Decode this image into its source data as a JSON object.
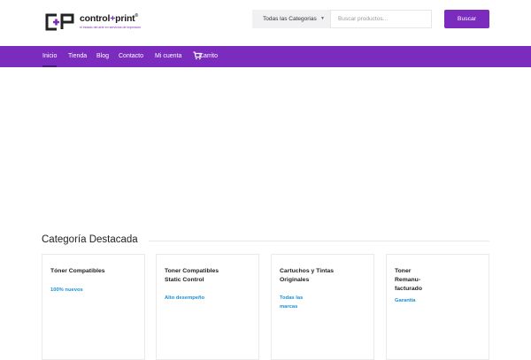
{
  "brand": {
    "name_prefix": "control",
    "name_plus": "+",
    "name_suffix": "print",
    "name_mark": "®",
    "tagline": "el estado del arte en servicios de impresión",
    "colors": {
      "primary": "#7b2cbf",
      "accent_link": "#1a8fd8"
    }
  },
  "search": {
    "category_label": "Todas las Categorias",
    "placeholder": "Buscar productos...",
    "button_label": "Buscar"
  },
  "nav": {
    "items": [
      {
        "label": "Inicio",
        "active": true
      },
      {
        "label": "Tienda"
      },
      {
        "label": "Blog"
      },
      {
        "label": "Contacto"
      },
      {
        "label": "Mi cuenta"
      },
      {
        "label": "Carrito",
        "icon": "cart-icon"
      }
    ]
  },
  "featured": {
    "title_part1": "Categoría",
    "title_part2": "Destacada",
    "cards": [
      {
        "title": "Tóner Compatibles",
        "subtitle": "100% nuevos"
      },
      {
        "title": "Toner Compatibles Static Control",
        "subtitle": "Alto desempeño"
      },
      {
        "title": "Cartuchos y Tintas Originales",
        "subtitle": "Todas las marcas"
      },
      {
        "title": "Toner Remanu-facturado",
        "subtitle": "Garantía"
      }
    ]
  }
}
